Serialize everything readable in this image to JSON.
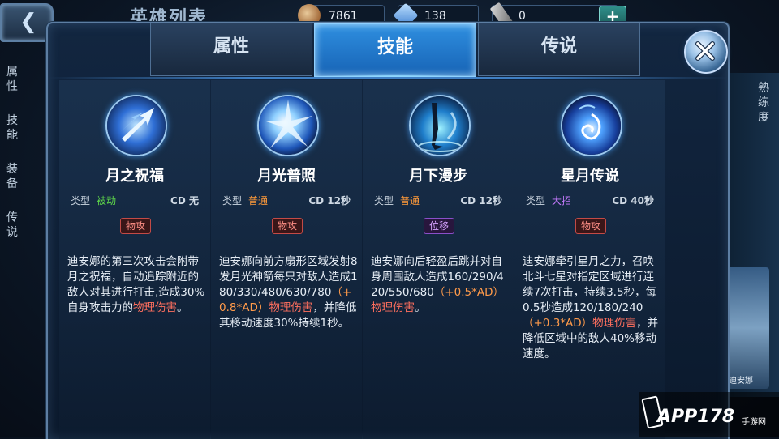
{
  "background": {
    "back_glyph": "❮",
    "title": "英雄列表",
    "resources": [
      {
        "icon": "gold-coin-icon",
        "value": "7861"
      },
      {
        "icon": "diamond-icon",
        "value": "138"
      },
      {
        "icon": "ticket-icon",
        "value": "0"
      }
    ],
    "add_label": "+",
    "left_tabs": [
      "属性",
      "技能",
      "装备",
      "传说"
    ],
    "right_label": "熟练度",
    "hero_thumb_label": "迪安娜"
  },
  "dialog": {
    "tabs": [
      "属性",
      "技能",
      "传说"
    ],
    "active_tab": "技能",
    "skills": [
      {
        "name": "月之祝福",
        "type_label": "类型",
        "type": "被动",
        "type_color": "#5fd84a",
        "cd": "CD 无",
        "badge": "物攻",
        "desc_parts": [
          "迪安娜的第三次攻击会附带月之祝福，自动追踪附近的敌人对其进行打击,造成30%自身攻击力的",
          "物理伤害",
          "。"
        ],
        "icon": "moon-arrow-icon"
      },
      {
        "name": "月光普照",
        "type_label": "类型",
        "type": "普通",
        "type_color": "#ff9a3a",
        "cd": "CD 12秒",
        "badge": "物攻",
        "desc_parts": [
          "迪安娜向前方扇形区域发射8发月光神箭每只对敌人造成180/330/480/630/780",
          "（+0.8*AD）",
          "物理伤害",
          "，并降低其移动速度30%持续1秒。"
        ],
        "icon": "moonlight-burst-icon"
      },
      {
        "name": "月下漫步",
        "type_label": "类型",
        "type": "普通",
        "type_color": "#ff9a3a",
        "cd": "CD 12秒",
        "badge": "位移",
        "desc_parts": [
          "迪安娜向后轻盈后跳并对自身周围敌人造成160/290/420/550/680",
          "（+0.5*AD）",
          "物理伤害",
          "。"
        ],
        "icon": "moon-leap-icon"
      },
      {
        "name": "星月传说",
        "type_label": "类型",
        "type": "大招",
        "type_color": "#c77bff",
        "cd": "CD 40秒",
        "badge": "物攻",
        "desc_parts": [
          "迪安娜牵引星月之力，召唤北斗七星对指定区域进行连续7次打击，持续3.5秒，每0.5秒造成120/180/240",
          "（+0.3*AD）",
          "物理伤害",
          "，并降低区域中的敌人40%移动速度。"
        ],
        "icon": "star-moon-icon"
      }
    ]
  },
  "watermark": {
    "text": "APP178",
    "sub": "手游网"
  }
}
